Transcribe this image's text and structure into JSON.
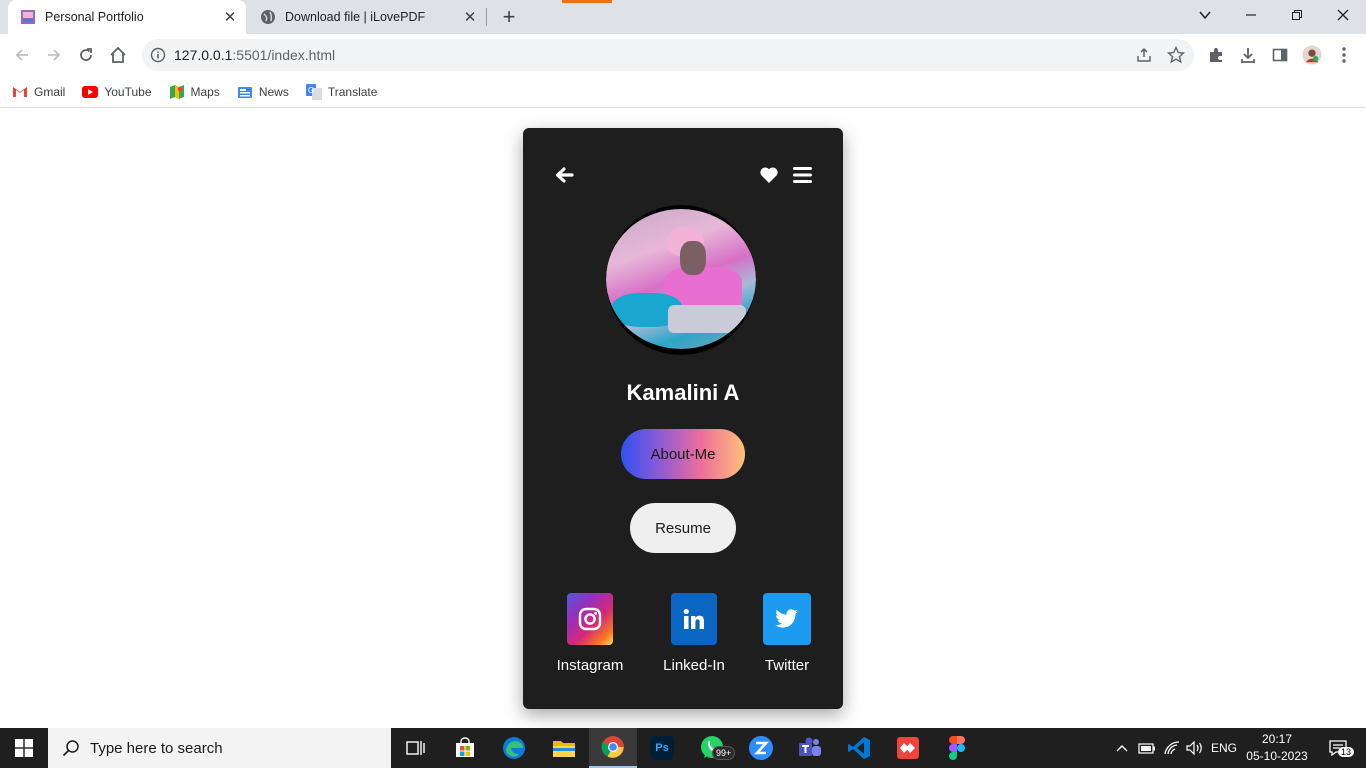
{
  "browser": {
    "tabs": [
      {
        "title": "Personal Portfolio",
        "active": true
      },
      {
        "title": "Download file | iLovePDF",
        "active": false
      }
    ],
    "close_glyph": "✕",
    "new_tab_glyph": "+",
    "url_host": "127.0.0.1",
    "url_path": ":5501/index.html",
    "bookmarks": [
      {
        "label": "Gmail",
        "icon": "gmail-icon"
      },
      {
        "label": "YouTube",
        "icon": "youtube-icon"
      },
      {
        "label": "Maps",
        "icon": "maps-icon"
      },
      {
        "label": "News",
        "icon": "news-icon"
      },
      {
        "label": "Translate",
        "icon": "translate-icon"
      }
    ]
  },
  "profile": {
    "name": "Kamalini A",
    "about_label": "About-Me",
    "resume_label": "Resume",
    "socials": [
      {
        "label": "Instagram",
        "icon": "instagram-icon",
        "color": "#d62976"
      },
      {
        "label": "Linked-In",
        "icon": "linkedin-icon",
        "color": "#0a66c2"
      },
      {
        "label": "Twitter",
        "icon": "twitter-icon",
        "color": "#1d9bf0"
      }
    ]
  },
  "taskbar": {
    "search_placeholder": "Type here to search",
    "whatsapp_badge": "99+",
    "language": "ENG",
    "time": "20:17",
    "date": "05-10-2023",
    "notification_count": "13"
  },
  "colors": {
    "card_bg": "#1e1e1e",
    "tab_strip": "#dee1e6",
    "taskbar": "#1f1f1f"
  }
}
